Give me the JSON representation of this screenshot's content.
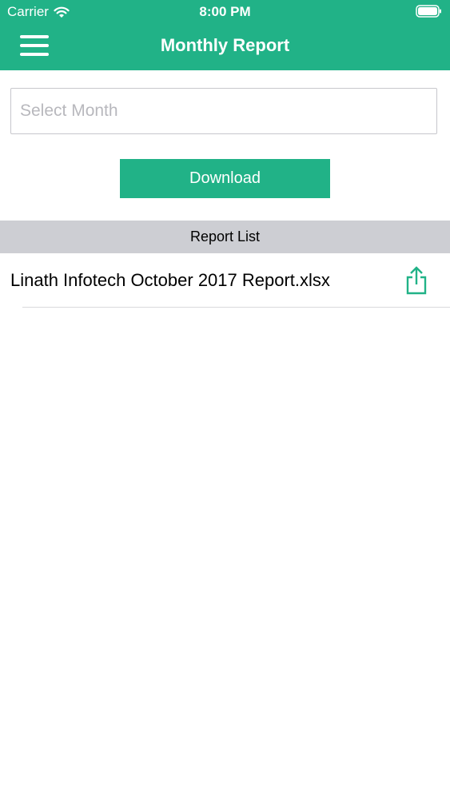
{
  "status_bar": {
    "carrier": "Carrier",
    "time": "8:00 PM",
    "wifi_icon": "wifi-icon",
    "battery_icon": "battery-icon"
  },
  "nav": {
    "title": "Monthly Report",
    "menu_icon": "hamburger-menu-icon"
  },
  "form": {
    "month_placeholder": "Select Month",
    "month_value": "",
    "download_label": "Download"
  },
  "report_list": {
    "header": "Report List",
    "items": [
      {
        "name": "Linath Infotech October 2017 Report.xlsx",
        "action_icon": "share-icon"
      }
    ]
  },
  "colors": {
    "accent": "#21b287",
    "section_header_bg": "#cdced3"
  }
}
